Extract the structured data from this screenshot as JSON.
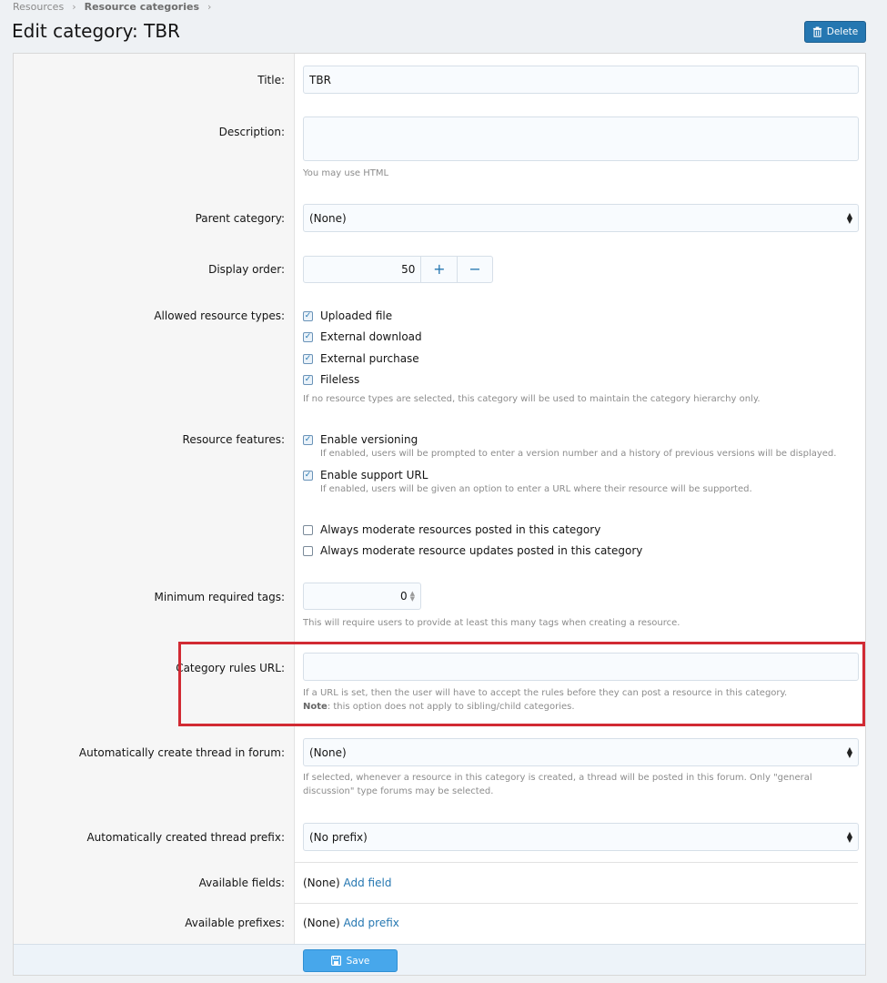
{
  "breadcrumb": {
    "items": [
      "Resources",
      "Resource categories"
    ]
  },
  "page": {
    "title": "Edit category: TBR",
    "delete_label": "Delete"
  },
  "form": {
    "title": {
      "label": "Title:",
      "value": "TBR"
    },
    "description": {
      "label": "Description:",
      "value": "",
      "hint": "You may use HTML"
    },
    "parent_category": {
      "label": "Parent category:",
      "value": "(None)"
    },
    "display_order": {
      "label": "Display order:",
      "value": "50",
      "plus": "+",
      "minus": "−"
    },
    "allowed_types": {
      "label": "Allowed resource types:",
      "options": [
        {
          "label": "Uploaded file",
          "checked": true
        },
        {
          "label": "External download",
          "checked": true
        },
        {
          "label": "External purchase",
          "checked": true
        },
        {
          "label": "Fileless",
          "checked": true
        }
      ],
      "hint": "If no resource types are selected, this category will be used to maintain the category hierarchy only."
    },
    "resource_features": {
      "label": "Resource features:",
      "options": [
        {
          "label": "Enable versioning",
          "checked": true,
          "hint": "If enabled, users will be prompted to enter a version number and a history of previous versions will be displayed."
        },
        {
          "label": "Enable support URL",
          "checked": true,
          "hint": "If enabled, users will be given an option to enter a URL where their resource will be supported."
        },
        {
          "label": "Always moderate resources posted in this category",
          "checked": false
        },
        {
          "label": "Always moderate resource updates posted in this category",
          "checked": false
        }
      ]
    },
    "min_tags": {
      "label": "Minimum required tags:",
      "value": "0",
      "hint": "This will require users to provide at least this many tags when creating a resource."
    },
    "rules_url": {
      "label": "Category rules URL:",
      "value": "",
      "hint": "If a URL is set, then the user will have to accept the rules before they can post a resource in this category.",
      "note_label": "Note",
      "note_text": ": this option does not apply to sibling/child categories."
    },
    "thread_forum": {
      "label": "Automatically create thread in forum:",
      "value": "(None)",
      "hint_line1": "If selected, whenever a resource in this category is created, a thread will be posted in this forum. Only \"general",
      "hint_line2": "discussion\" type forums may be selected."
    },
    "thread_prefix": {
      "label": "Automatically created thread prefix:",
      "value": "(No prefix)"
    },
    "available_fields": {
      "label": "Available fields:",
      "value": "(None)",
      "link": "Add field"
    },
    "available_prefixes": {
      "label": "Available prefixes:",
      "value": "(None)",
      "link": "Add prefix"
    }
  },
  "footer": {
    "save_label": "Save"
  },
  "colors": {
    "accent": "#2577b1",
    "save": "#47a7eb",
    "highlight": "#d12a33"
  }
}
